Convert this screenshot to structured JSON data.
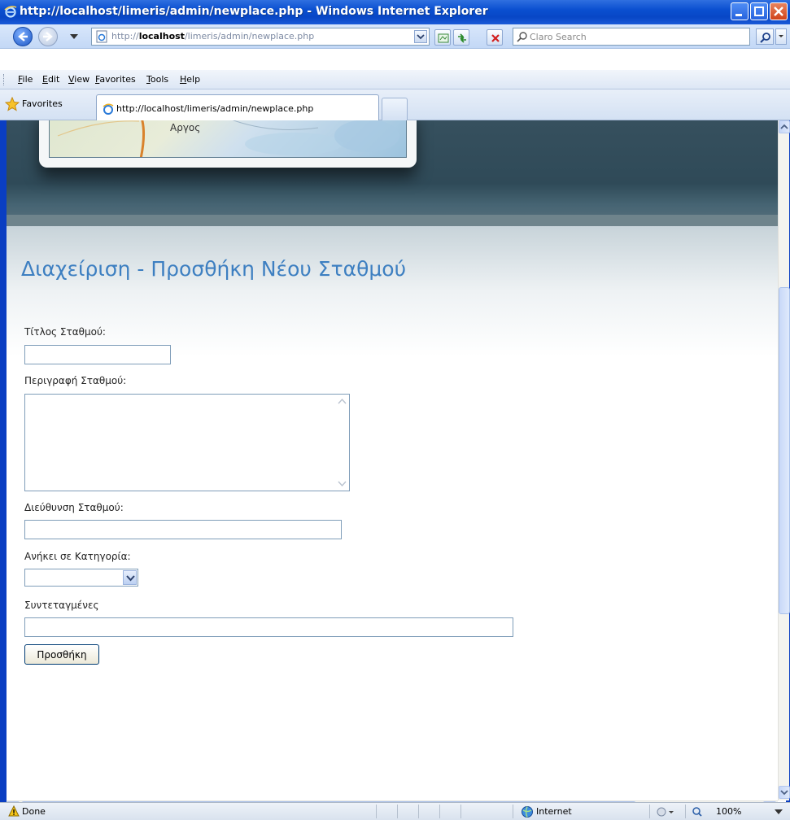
{
  "window": {
    "title": "http://localhost/limeris/admin/newplace.php - Windows Internet Explorer"
  },
  "address_bar": {
    "url_prefix": "http://",
    "url_host": "localhost",
    "url_path": "/limeris/admin/newplace.php",
    "search_placeholder": "Claro Search"
  },
  "menu": {
    "items": [
      "File",
      "Edit",
      "View",
      "Favorites",
      "Tools",
      "Help"
    ]
  },
  "favorites_bar": {
    "label": "Favorites",
    "tab_title": "http://localhost/limeris/admin/newplace.php"
  },
  "banner": {
    "map_label": "Αργος"
  },
  "page": {
    "title": "Διαχείριση - Προσθήκη Νέου Σταθμού",
    "form": {
      "title_label": "Τίτλος Σταθμού:",
      "title_value": "",
      "description_label": "Περιγραφή Σταθμού:",
      "description_value": "",
      "address_label": "Διεύθυνση Σταθμού:",
      "address_value": "",
      "category_label": "Ανήκει σε Κατηγορία:",
      "category_value": "",
      "coords_label": "Συντεταγμένες",
      "coords_value": "",
      "submit_label": "Προσθήκη"
    }
  },
  "status_bar": {
    "status": "Done",
    "zone": "Internet",
    "zoom": "100%"
  },
  "colors": {
    "title_blue": "#3d7fc1",
    "xp_blue": "#0a4fd0"
  }
}
